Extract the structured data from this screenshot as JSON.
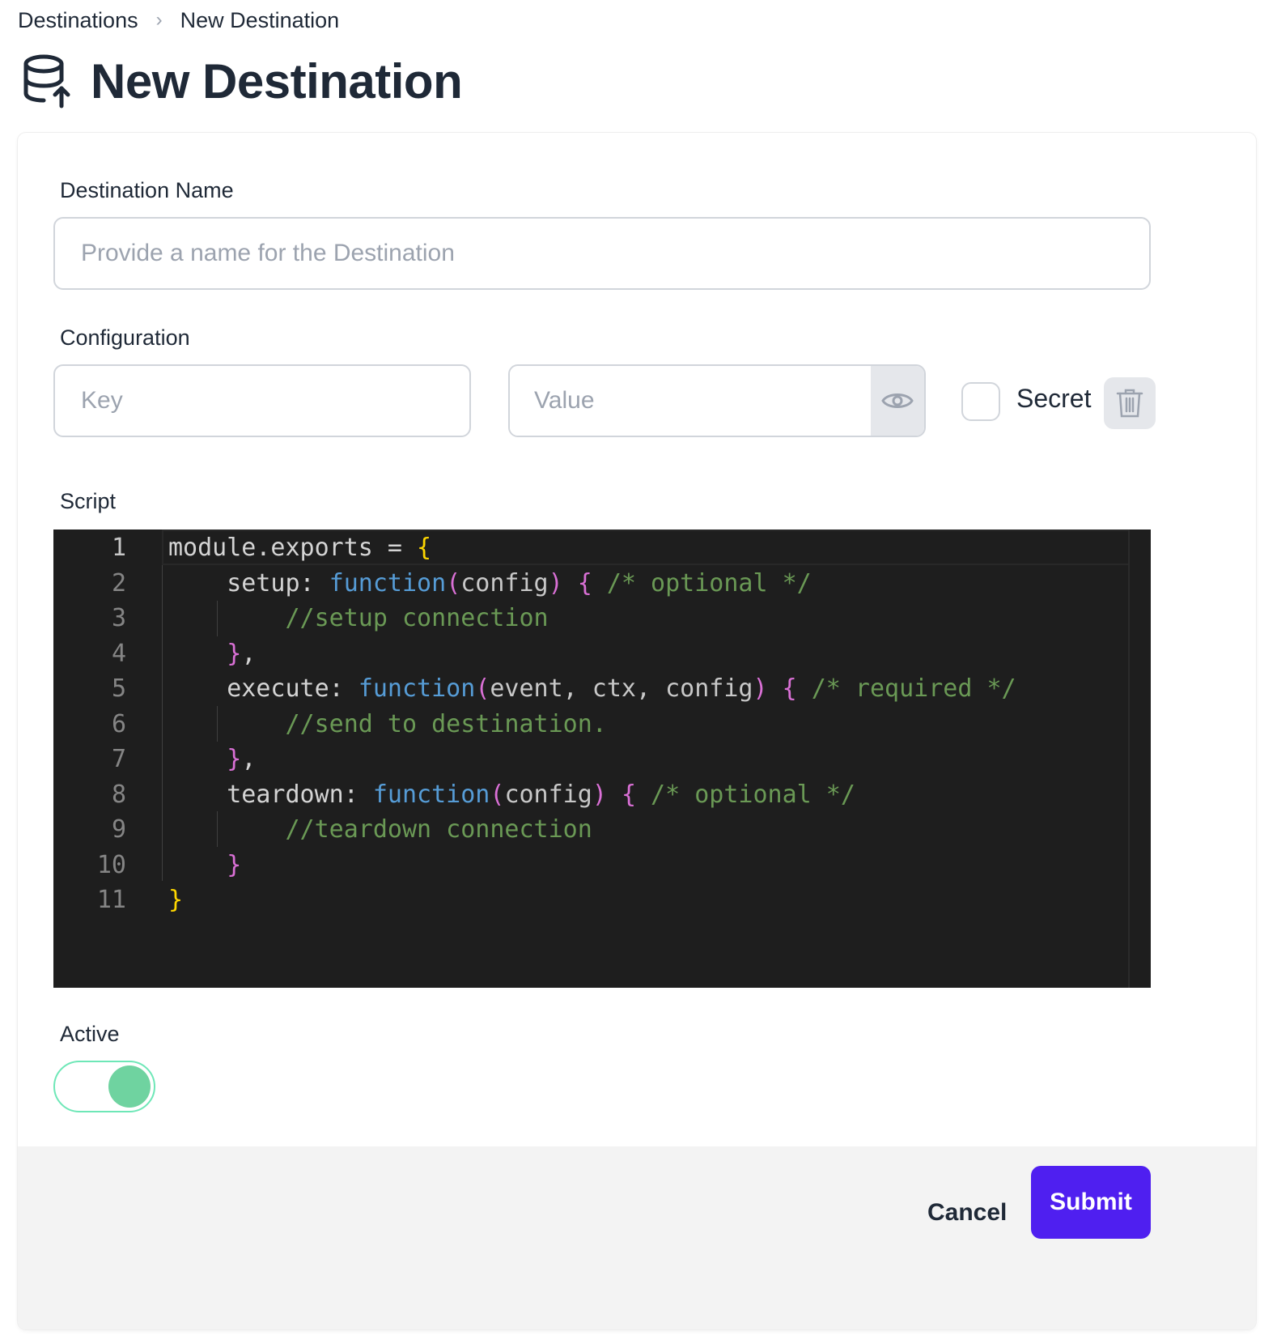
{
  "breadcrumb": {
    "items": [
      "Destinations",
      "New Destination"
    ]
  },
  "page": {
    "title": "New Destination",
    "icon": "database-upload-icon"
  },
  "form": {
    "name_label": "Destination Name",
    "name_placeholder": "Provide a name for the Destination",
    "config_label": "Configuration",
    "key_placeholder": "Key",
    "value_placeholder": "Value",
    "secret_label": "Secret",
    "secret_checked": false,
    "script_label": "Script",
    "active_label": "Active",
    "active": true
  },
  "editor": {
    "line_numbers": [
      "1",
      "2",
      "3",
      "4",
      "5",
      "6",
      "7",
      "8",
      "9",
      "10",
      "11"
    ],
    "lines": [
      [
        [
          "module.exports = ",
          "plain"
        ],
        [
          "{",
          "brace-y"
        ]
      ],
      [
        [
          "    setup: ",
          "plain"
        ],
        [
          "function",
          "kw"
        ],
        [
          "(",
          "brace-p"
        ],
        [
          "config",
          "param"
        ],
        [
          ")",
          "brace-p"
        ],
        [
          " ",
          "plain"
        ],
        [
          "{",
          "brace-p"
        ],
        [
          " /* optional */",
          "comment"
        ]
      ],
      [
        [
          "        //setup connection",
          "comment"
        ]
      ],
      [
        [
          "    ",
          "plain"
        ],
        [
          "}",
          "brace-p"
        ],
        [
          ",",
          "plain"
        ]
      ],
      [
        [
          "    execute: ",
          "plain"
        ],
        [
          "function",
          "kw"
        ],
        [
          "(",
          "brace-p"
        ],
        [
          "event, ctx, config",
          "param"
        ],
        [
          ")",
          "brace-p"
        ],
        [
          " ",
          "plain"
        ],
        [
          "{",
          "brace-p"
        ],
        [
          " /* required */",
          "comment"
        ]
      ],
      [
        [
          "        //send to destination.",
          "comment"
        ]
      ],
      [
        [
          "    ",
          "plain"
        ],
        [
          "}",
          "brace-p"
        ],
        [
          ",",
          "plain"
        ]
      ],
      [
        [
          "    teardown: ",
          "plain"
        ],
        [
          "function",
          "kw"
        ],
        [
          "(",
          "brace-p"
        ],
        [
          "config",
          "param"
        ],
        [
          ")",
          "brace-p"
        ],
        [
          " ",
          "plain"
        ],
        [
          "{",
          "brace-p"
        ],
        [
          " /* optional */",
          "comment"
        ]
      ],
      [
        [
          "        //teardown connection",
          "comment"
        ]
      ],
      [
        [
          "    ",
          "plain"
        ],
        [
          "}",
          "brace-p"
        ]
      ],
      [
        [
          "}",
          "brace-y"
        ]
      ]
    ]
  },
  "footer": {
    "cancel_label": "Cancel",
    "submit_label": "Submit"
  },
  "colors": {
    "accent": "#4f1ff0",
    "toggle_on": "#6fd3a0",
    "editor_bg": "#1e1e1e"
  }
}
